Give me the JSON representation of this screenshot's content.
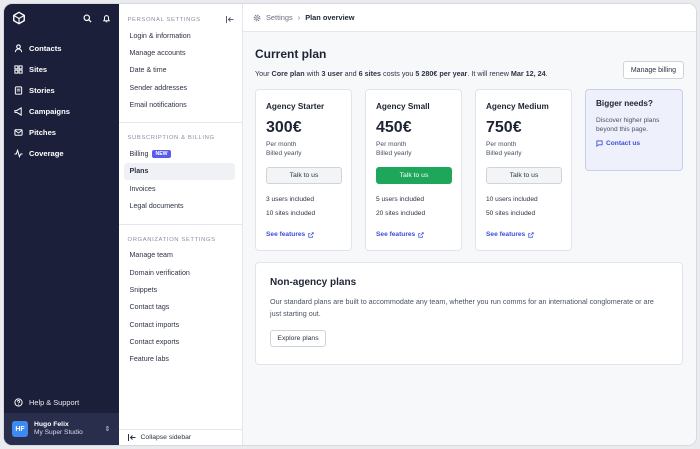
{
  "nav": {
    "items": [
      {
        "label": "Contacts",
        "icon": "users-icon"
      },
      {
        "label": "Sites",
        "icon": "grid-icon"
      },
      {
        "label": "Stories",
        "icon": "layers-icon"
      },
      {
        "label": "Campaigns",
        "icon": "megaphone-icon"
      },
      {
        "label": "Pitches",
        "icon": "mail-icon"
      },
      {
        "label": "Coverage",
        "icon": "activity-icon"
      }
    ],
    "help_label": "Help & Support",
    "user": {
      "initials": "HF",
      "name": "Hugo Felix",
      "org": "My Super Studio"
    }
  },
  "settings": {
    "personal_title": "Personal settings",
    "personal_items": [
      "Login & information",
      "Manage accounts",
      "Date & time",
      "Sender addresses",
      "Email notifications"
    ],
    "billing_title": "Subscription & billing",
    "billing_items": [
      "Billing",
      "Plans",
      "Invoices",
      "Legal documents"
    ],
    "billing_badge": "NEW",
    "org_title": "Organization settings",
    "org_items": [
      "Manage team",
      "Domain verification",
      "Snippets",
      "Contact tags",
      "Contact imports",
      "Contact exports",
      "Feature labs"
    ],
    "collapse_label": "Collapse sidebar"
  },
  "breadcrumb": {
    "parent": "Settings",
    "current": "Plan overview"
  },
  "current_plan": {
    "title": "Current plan",
    "line_prefix": "Your ",
    "plan_name": "Core plan",
    "line_with": " with ",
    "users": "3 user",
    "line_and": " and ",
    "sites": "6 sites",
    "line_costs": " costs you ",
    "price": "5 280€ per year",
    "line_renew": ". It will renew ",
    "renew_date": "Mar 12, 24",
    "line_end": ".",
    "manage_billing": "Manage billing"
  },
  "plans": [
    {
      "name": "Agency Starter",
      "price": "300€",
      "per": "Per month",
      "billed": "Billed yearly",
      "button": "Talk to us",
      "primary": false,
      "users": "3 users included",
      "sites": "10 sites included",
      "features": "See features"
    },
    {
      "name": "Agency Small",
      "price": "450€",
      "per": "Per month",
      "billed": "Billed yearly",
      "button": "Talk to us",
      "primary": true,
      "users": "5 users included",
      "sites": "20 sites included",
      "features": "See features"
    },
    {
      "name": "Agency Medium",
      "price": "750€",
      "per": "Per month",
      "billed": "Billed yearly",
      "button": "Talk to us",
      "primary": false,
      "users": "10 users included",
      "sites": "50 sites included",
      "features": "See features"
    }
  ],
  "bigger": {
    "title": "Bigger needs?",
    "text": "Discover higher plans beyond this page.",
    "contact": "Contact us"
  },
  "non_agency": {
    "title": "Non-agency plans",
    "text": "Our standard plans are built to accommodate any team, whether you run comms for an international conglomerate or are just starting out.",
    "button": "Explore plans"
  },
  "colors": {
    "sidebar": "#1c1f3a",
    "accent": "#1ea75a",
    "link": "#3b4fd8",
    "badge": "#5a5cf0"
  }
}
